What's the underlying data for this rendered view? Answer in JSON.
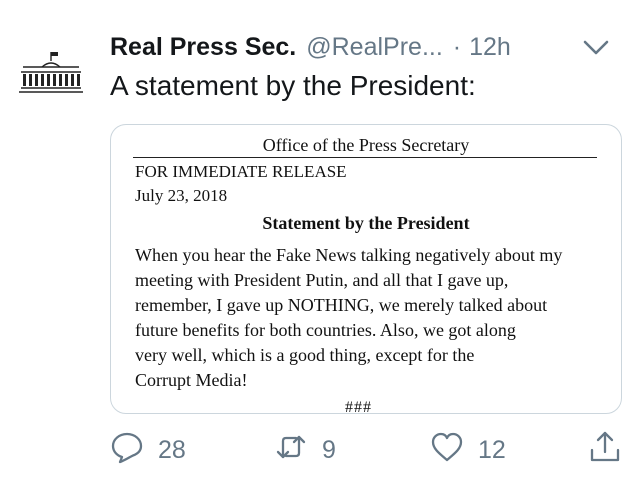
{
  "tweet": {
    "display_name": "Real Press Sec.",
    "handle": "@RealPre...",
    "separator": "·",
    "timestamp": "12h",
    "text": "A statement by the President:"
  },
  "card": {
    "office": "Office of the Press Secretary",
    "release": "FOR IMMEDIATE RELEASE",
    "date": "July 23, 2018",
    "title": "Statement by the President",
    "body_lines": [
      "When you hear the Fake News talking negatively about my",
      "meeting with President Putin, and all that I gave up,",
      "remember, I gave up NOTHING, we merely talked about",
      "future benefits for both countries. Also, we got along",
      "very well, which is a good thing, except for the",
      "Corrupt Media!"
    ],
    "end_mark": "###"
  },
  "actions": {
    "reply_count": "28",
    "retweet_count": "9",
    "like_count": "12"
  },
  "icons": {
    "avatar": "white-house-icon",
    "menu": "chevron-down-icon",
    "reply": "reply-icon",
    "retweet": "retweet-icon",
    "like": "heart-icon",
    "share": "share-icon"
  },
  "colors": {
    "text": "#14171a",
    "secondary": "#657786",
    "card_border": "#ccd6dd"
  }
}
